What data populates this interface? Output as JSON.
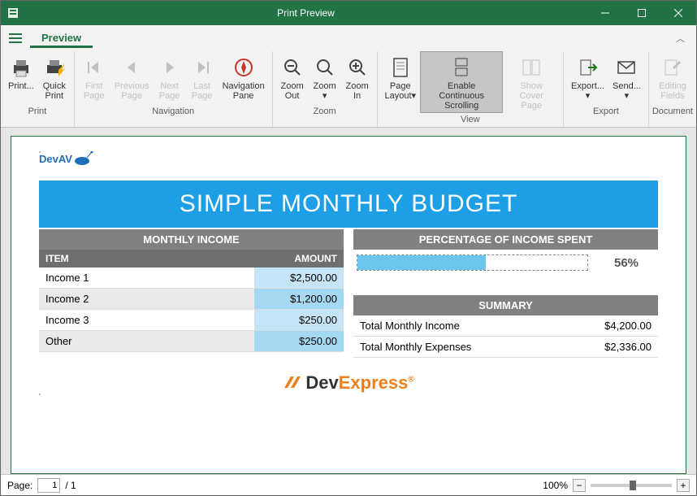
{
  "window": {
    "title": "Print Preview"
  },
  "tabs": {
    "preview": "Preview"
  },
  "ribbon": {
    "print": {
      "label": "Print",
      "print": "Print...",
      "quick": "Quick\nPrint"
    },
    "navigation": {
      "label": "Navigation",
      "first": "First\nPage",
      "prev": "Previous\nPage",
      "next": "Next\nPage",
      "last": "Last\nPage",
      "pane": "Navigation\nPane"
    },
    "zoom": {
      "label": "Zoom",
      "out": "Zoom\nOut",
      "zoom": "Zoom\n▾",
      "in": "Zoom\nIn"
    },
    "view": {
      "label": "View",
      "layout": "Page\nLayout▾",
      "scroll": "Enable Continuous\nScrolling",
      "cover": "Show Cover\nPage"
    },
    "export": {
      "label": "Export",
      "export": "Export...\n▾",
      "send": "Send...\n▾"
    },
    "document": {
      "label": "Document",
      "fields": "Editing\nFields"
    }
  },
  "doc": {
    "logo": "DevAV",
    "title": "SIMPLE MONTHLY BUDGET",
    "income_header": "MONTHLY INCOME",
    "item_col": "ITEM",
    "amount_col": "AMOUNT",
    "rows": [
      {
        "item": "Income 1",
        "amount": "$2,500.00"
      },
      {
        "item": "Income 2",
        "amount": "$1,200.00"
      },
      {
        "item": "Income 3",
        "amount": "$250.00"
      },
      {
        "item": "Other",
        "amount": "$250.00"
      }
    ],
    "pct_header": "PERCENTAGE OF INCOME SPENT",
    "pct_value": "56%",
    "summary_header": "SUMMARY",
    "summary": [
      {
        "label": "Total Monthly Income",
        "value": "$4,200.00"
      },
      {
        "label": "Total Monthly Expenses",
        "value": "$2,336.00"
      }
    ],
    "footer_dev": "Dev",
    "footer_exp": "Express"
  },
  "status": {
    "page_label": "Page:",
    "current": "1",
    "total": "/ 1",
    "zoom": "100%"
  }
}
